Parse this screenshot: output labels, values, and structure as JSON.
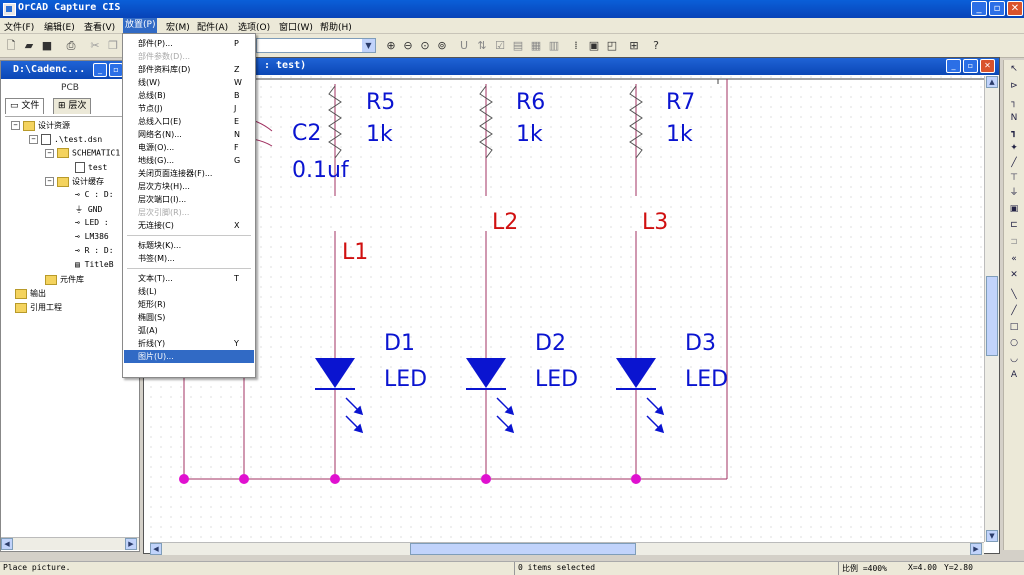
{
  "app_title": "OrCAD Capture CIS",
  "menubar": [
    {
      "label": "文件(F)"
    },
    {
      "label": "编辑(E)"
    },
    {
      "label": "查看(V)"
    },
    {
      "label": "放置(P)"
    },
    {
      "label": "宏(M)"
    },
    {
      "label": "配件(A)"
    },
    {
      "label": "选项(O)"
    },
    {
      "label": "窗口(W)"
    },
    {
      "label": "帮助(H)"
    }
  ],
  "place_menu": [
    {
      "label": "部件(P)...",
      "key": "P",
      "disabled": false
    },
    {
      "label": "部件参数(D)...",
      "key": "",
      "disabled": true
    },
    {
      "label": "部件资料库(D)",
      "key": "Z",
      "disabled": false
    },
    {
      "label": "线(W)",
      "key": "W",
      "disabled": false
    },
    {
      "label": "总线(B)",
      "key": "B",
      "disabled": false
    },
    {
      "label": "节点(J)",
      "key": "J",
      "disabled": false
    },
    {
      "label": "总线入口(E)",
      "key": "E",
      "disabled": false
    },
    {
      "label": "网络名(N)...",
      "key": "N",
      "disabled": false
    },
    {
      "label": "电源(O)...",
      "key": "F",
      "disabled": false
    },
    {
      "label": "地线(G)...",
      "key": "G",
      "disabled": false
    },
    {
      "label": "关闭页面连接器(F)...",
      "key": "",
      "disabled": false
    },
    {
      "label": "层次方块(H)...",
      "key": "",
      "disabled": false
    },
    {
      "label": "层次端口(I)...",
      "key": "",
      "disabled": false
    },
    {
      "label": "层次引脚(R)...",
      "key": "",
      "disabled": true
    },
    {
      "label": "无连接(C)",
      "key": "X",
      "disabled": false
    },
    {
      "label": "标题块(K)...",
      "key": "",
      "disabled": false
    },
    {
      "label": "书签(M)...",
      "key": "",
      "disabled": false
    },
    {
      "label": "文本(T)...",
      "key": "T",
      "disabled": false
    },
    {
      "label": "线(L)",
      "key": "",
      "disabled": false
    },
    {
      "label": "矩形(R)",
      "key": "",
      "disabled": false
    },
    {
      "label": "椭圆(S)",
      "key": "",
      "disabled": false
    },
    {
      "label": "弧(A)",
      "key": "",
      "disabled": false
    },
    {
      "label": "折线(Y)",
      "key": "Y",
      "disabled": false
    },
    {
      "label": "图片(U)...",
      "key": "",
      "disabled": false,
      "highlighted": true
    }
  ],
  "project": {
    "window_title": "D:\\Cadenc...",
    "pcb_label": "PCB",
    "tabs": [
      "文件",
      "层次"
    ],
    "tree": {
      "root": "设计资源",
      "dsn": ".\\test.dsn",
      "schematic": "SCHEMATIC1",
      "page": "test",
      "cache": "设计缓存",
      "cache_items": [
        "C : D:",
        "GND",
        "LED :",
        "LM386",
        "R : D:",
        "TitleB"
      ],
      "library": "元件库",
      "output": "输出",
      "refs": "引用工程"
    }
  },
  "schematic_window": {
    "title": ": test)",
    "components": {
      "capacitor": {
        "ref": "C2",
        "value": "0.1uf"
      },
      "resistors": [
        {
          "ref": "R5",
          "value": "1k"
        },
        {
          "ref": "R6",
          "value": "1k"
        },
        {
          "ref": "R7",
          "value": "1k"
        }
      ],
      "net_labels": [
        "L1",
        "L2",
        "L3"
      ],
      "leds": [
        {
          "ref": "D1",
          "value": "LED"
        },
        {
          "ref": "D2",
          "value": "LED"
        },
        {
          "ref": "D3",
          "value": "LED"
        }
      ]
    },
    "colors": {
      "wire": "#a03060",
      "part": "#0a14d0",
      "label": "#d01010",
      "junction": "#e010d0"
    }
  },
  "statusbar": {
    "message": "Place picture.",
    "selection": "0 items selected",
    "zoom": "比例 =400%",
    "x": "X=4.00",
    "y": "Y=2.80"
  }
}
